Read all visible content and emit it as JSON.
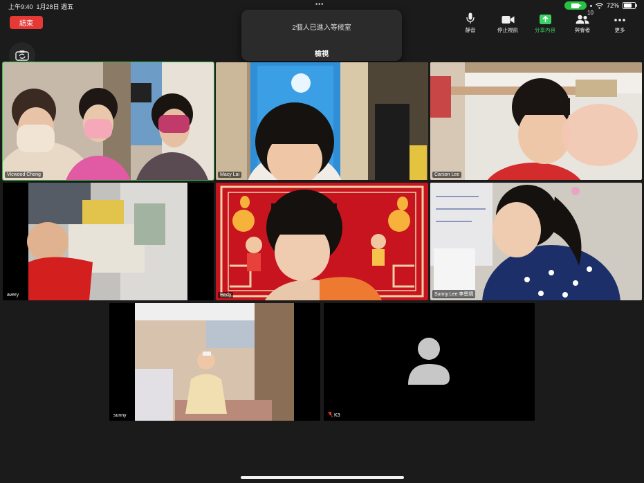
{
  "status_bar": {
    "time": "上午9:40",
    "date": "1月28日 週五",
    "battery": "72%",
    "battery_level": 0.72,
    "dots": "•••"
  },
  "meeting": {
    "end_label": "結束"
  },
  "waiting_room": {
    "message": "2個人已進入等候室",
    "view_label": "檢視"
  },
  "toolbar": {
    "mute_label": "靜音",
    "stop_video_label": "停止視訊",
    "share_label": "分享內容",
    "participants_label": "與會者",
    "participants_count": "10",
    "more_label": "更多"
  },
  "colors": {
    "end": "#e53935",
    "share": "#3dd163",
    "active_speaker": "#36c24c"
  },
  "participants": [
    {
      "name": "Vicwood Chong",
      "active": true
    },
    {
      "name": "Macy Lai"
    },
    {
      "name": "Carson Lee"
    },
    {
      "name": "avery"
    },
    {
      "name": "Hedy"
    },
    {
      "name": "Sunny Lee 李恩晴"
    },
    {
      "name": "sunny"
    },
    {
      "name": "K3",
      "video_off": true,
      "icon": "mic-muted-icon"
    }
  ]
}
